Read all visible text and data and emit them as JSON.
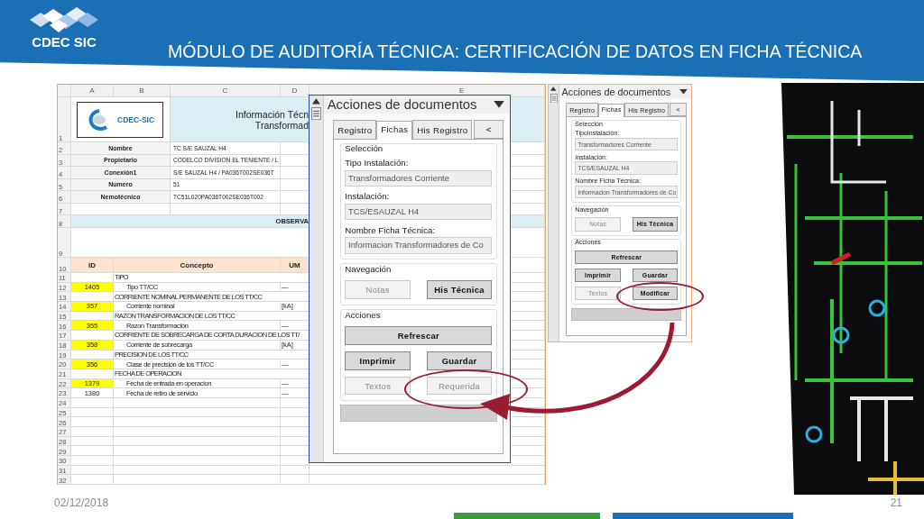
{
  "header": {
    "logo_text": "CDEC SIC",
    "title": "MÓDULO DE AUDITORÍA TÉCNICA: CERTIFICACIÓN DE DATOS EN FICHA TÉCNICA"
  },
  "sheet": {
    "columns": [
      "A",
      "B",
      "C",
      "D",
      "E"
    ],
    "rows": [
      {
        "number": "1",
        "kind": "title",
        "logo_text": "CDEC-SIC",
        "lines": [
          "Información Técn",
          "Transformad"
        ]
      },
      {
        "number": "2",
        "kind": "info",
        "label": "Nombre",
        "value": "TC S/E SAUZAL H4"
      },
      {
        "number": "3",
        "kind": "info",
        "label": "Propietario",
        "value": "CODELCO DIVISION EL TENIENTE / L"
      },
      {
        "number": "4",
        "kind": "info",
        "label": "Conexión1",
        "value": "S/E SAUZAL H4 / PA036T002SE036T"
      },
      {
        "number": "5",
        "kind": "info",
        "label": "Numero",
        "value": "51"
      },
      {
        "number": "6",
        "kind": "info",
        "label": "Nemotécnico",
        "value": "TC51L020PA036T002SE036T002"
      },
      {
        "number": "7",
        "kind": "blank"
      },
      {
        "number": "8",
        "kind": "band",
        "text": "OBSERVA"
      },
      {
        "number": "9",
        "kind": "tall"
      },
      {
        "number": "10",
        "kind": "head",
        "cells": [
          "ID",
          "Concepto",
          "UM"
        ]
      },
      {
        "number": "11",
        "kind": "group",
        "concept": "TIPO"
      },
      {
        "number": "12",
        "kind": "item",
        "id": "1405",
        "concept": "Tipo TT/CC",
        "unit": "—",
        "highlighted": true
      },
      {
        "number": "13",
        "kind": "group",
        "concept": "CORRIENTE NOMINAL PERMANENTE DE LOS TT/CC"
      },
      {
        "number": "14",
        "kind": "item",
        "id": "357",
        "concept": "Corriente nominal",
        "unit": "[kA]",
        "highlighted": true
      },
      {
        "number": "15",
        "kind": "group",
        "concept": "RAZON TRANSFORMACION DE LOS TT/CC"
      },
      {
        "number": "16",
        "kind": "item",
        "id": "355",
        "concept": "Razon Transformación",
        "unit": "—",
        "highlighted": true
      },
      {
        "number": "17",
        "kind": "group",
        "concept": "CORRIENTE DE SOBRECARGA DE CORTA DURACION DE LOS TT/"
      },
      {
        "number": "18",
        "kind": "item",
        "id": "358",
        "concept": "Corriente de sobrecarga",
        "unit": "[kA]",
        "highlighted": true
      },
      {
        "number": "19",
        "kind": "group",
        "concept": "PRECISION DE LOS TT/CC"
      },
      {
        "number": "20",
        "kind": "item",
        "id": "356",
        "concept": "Clase de precisión de los TT/CC",
        "unit": "—",
        "highlighted": true
      },
      {
        "number": "21",
        "kind": "group",
        "concept": "FECHA DE OPERACION"
      },
      {
        "number": "22",
        "kind": "item",
        "id": "1379",
        "concept": "Fecha de entrada en operacion",
        "unit": "—",
        "highlighted": true
      },
      {
        "number": "23",
        "kind": "item",
        "id": "1380",
        "concept": "Fecha de retiro de servicio",
        "unit": "—",
        "highlighted": false
      },
      {
        "number": "24",
        "kind": "empty"
      },
      {
        "number": "25",
        "kind": "empty"
      },
      {
        "number": "26",
        "kind": "empty"
      },
      {
        "number": "27",
        "kind": "empty"
      },
      {
        "number": "28",
        "kind": "empty"
      },
      {
        "number": "29",
        "kind": "empty"
      },
      {
        "number": "30",
        "kind": "empty"
      },
      {
        "number": "31",
        "kind": "empty"
      },
      {
        "number": "32",
        "kind": "empty"
      }
    ]
  },
  "panels": [
    {
      "title": "Acciones de documentos",
      "tabs": [
        {
          "label": "Registro",
          "selected": false
        },
        {
          "label": "Fichas",
          "selected": true
        },
        {
          "label": "His Registro",
          "selected": false
        }
      ],
      "tab_scroll": "<",
      "groups": [
        {
          "kind": "fields",
          "legend": "Selección",
          "fields": [
            {
              "label": "Tipo Instalación:",
              "value": "Transformadores Corriente"
            },
            {
              "label": "Instalación:",
              "value": "TCS/ESAUZAL H4"
            },
            {
              "label": "Nombre Ficha Técnica:",
              "value": "Informacion Transformadores de Co"
            }
          ]
        },
        {
          "kind": "buttons",
          "legend": "Navegación",
          "rows": [
            [
              {
                "label": "Notas",
                "disabled": true,
                "circled": false
              },
              {
                "label": "His Técnica",
                "disabled": false,
                "circled": false
              }
            ]
          ]
        },
        {
          "kind": "buttons",
          "legend": "Acciones",
          "rows": [
            [
              {
                "label": "Refrescar",
                "disabled": false,
                "circled": false
              }
            ],
            [
              {
                "label": "Imprimir",
                "disabled": false,
                "circled": false
              },
              {
                "label": "Guardar",
                "disabled": false,
                "circled": false
              }
            ],
            [
              {
                "label": "Textos",
                "disabled": true,
                "circled": false
              },
              {
                "label": "Requerida",
                "disabled": true,
                "circled": true
              }
            ]
          ]
        }
      ]
    },
    {
      "title": "Acciones de documentos",
      "tabs": [
        {
          "label": "Registro",
          "selected": false
        },
        {
          "label": "Fichas",
          "selected": true
        },
        {
          "label": "His Registro",
          "selected": false
        }
      ],
      "tab_scroll": "<",
      "groups": [
        {
          "kind": "fields",
          "legend": "Selección",
          "fields": [
            {
              "label": "TipoInstalación:",
              "value": "Transformadores Corriente"
            },
            {
              "label": "Instalación:",
              "value": "TCS/ESAUZAL H4"
            },
            {
              "label": "Nombre Ficha Técnica:",
              "value": "Informacion Transformadores de Co"
            }
          ]
        },
        {
          "kind": "buttons",
          "legend": "Navegación",
          "rows": [
            [
              {
                "label": "Notas",
                "disabled": true,
                "circled": false
              },
              {
                "label": "His Técnica",
                "disabled": false,
                "circled": false
              }
            ]
          ]
        },
        {
          "kind": "buttons",
          "legend": "Acciones",
          "rows": [
            [
              {
                "label": "Refrescar",
                "disabled": false,
                "circled": false
              }
            ],
            [
              {
                "label": "Imprimir",
                "disabled": false,
                "circled": false
              },
              {
                "label": "Guardar",
                "disabled": false,
                "circled": false
              }
            ],
            [
              {
                "label": "Textos",
                "disabled": true,
                "circled": false
              },
              {
                "label": "Modificar",
                "disabled": false,
                "circled": true
              }
            ]
          ]
        }
      ]
    }
  ],
  "footer": {
    "date": "02/12/2018",
    "page": "21"
  }
}
